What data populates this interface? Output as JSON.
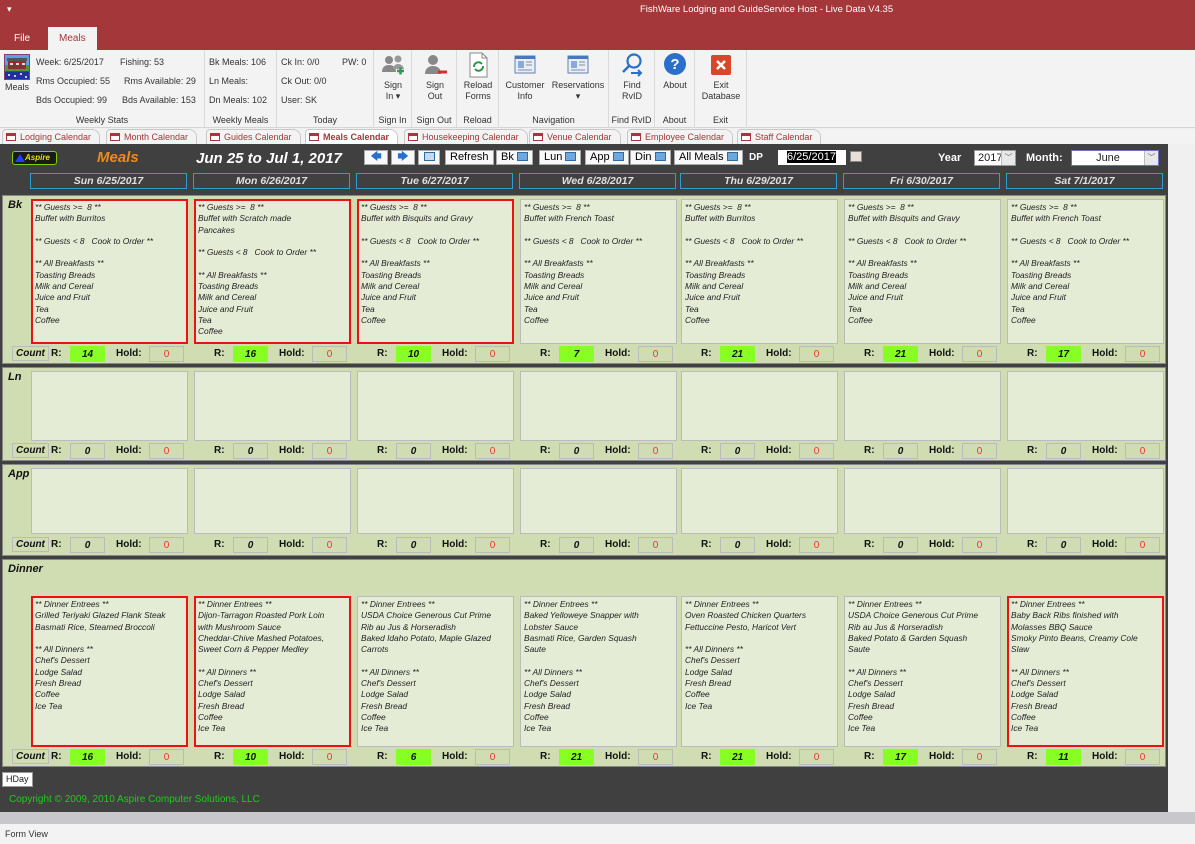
{
  "window": {
    "quick_access": "▾",
    "title": "FishWare Lodging and GuideService Host - Live Data V4.35"
  },
  "ribbon_tabs": [
    "File",
    "Meals"
  ],
  "ribbon": {
    "meals_button": "Meals",
    "weekly_stats": {
      "week": "Week:  6/25/2017",
      "fishing": "Fishing:  53",
      "rms_occupied": "Rms Occupied:  55",
      "rms_available": "Rms Available:  29",
      "bds_occupied": "Bds Occupied:    99",
      "bds_available": "Bds Available:  153",
      "label": "Weekly Stats"
    },
    "weekly_meals": {
      "bk": "Bk Meals:  106",
      "ln": "Ln Meals:",
      "dn": "Dn Meals:  102",
      "label": "Weekly Meals"
    },
    "today": {
      "ck_in": "Ck In:    0/0",
      "pw": "PW: 0",
      "ck_out": "Ck Out:  0/0",
      "user": "User: SK",
      "label": "Today"
    },
    "buttons": [
      {
        "line1": "Sign",
        "line2": "In ▾",
        "group": "Sign In"
      },
      {
        "line1": "Sign",
        "line2": "Out",
        "group": "Sign Out"
      },
      {
        "line1": "Reload",
        "line2": "Forms",
        "group": "Reload"
      },
      {
        "line1": "Customer",
        "line2": "Info",
        "group": ""
      },
      {
        "line1": "Reservations",
        "line2": "▾",
        "group": ""
      },
      {
        "line1": "Find",
        "line2": "RvID",
        "group": "Find RvID"
      },
      {
        "line1": "About",
        "line2": "",
        "group": "About"
      },
      {
        "line1": "Exit",
        "line2": "Database",
        "group": "Exit"
      }
    ],
    "navigation_label": "Navigation"
  },
  "doc_tabs": [
    "Lodging Calendar",
    "Month Calendar",
    "Guides Calendar",
    "Meals Calendar",
    "Housekeeping Calendar",
    "Venue Calendar",
    "Employee Calendar",
    "Staff Calendar"
  ],
  "active_doc_tab": "Meals Calendar",
  "header": {
    "logo": "Aspire",
    "title": "Meals",
    "range": "Jun 25 to Jul 1, 2017",
    "prev_icon": "🡄",
    "next_icon": "🡆",
    "refresh": "Refresh",
    "bk": "Bk",
    "lun": "Lun",
    "app": "App",
    "din": "Din",
    "all_meals": "All Meals",
    "dp_label": "DP",
    "dp_value": "6/25/2017",
    "year_label": "Year",
    "year_value": "2017",
    "month_label": "Month:",
    "month_value": "June",
    "days": [
      "Sun 6/25/2017",
      "Mon 6/26/2017",
      "Tue 6/27/2017",
      "Wed 6/28/2017",
      "Thu 6/29/2017",
      "Fri 6/30/2017",
      "Sat 7/1/2017"
    ]
  },
  "labels": {
    "count": "Count",
    "r": "R:",
    "hold": "Hold:"
  },
  "sections": {
    "bk": {
      "label": "Bk",
      "menus": [
        "** Guests >=  8 **\nBuffet with Burritos\n\n** Guests < 8   Cook to Order **\n\n** All Breakfasts **\nToasting Breads\nMilk and Cereal\nJuice and Fruit\nTea\nCoffee",
        "** Guests >=  8 **\nBuffet with Scratch made\nPancakes\n\n** Guests < 8   Cook to Order **\n\n** All Breakfasts **\nToasting Breads\nMilk and Cereal\nJuice and Fruit\nTea\nCoffee",
        "** Guests >=  8 **\nBuffet with Bisquits and Gravy\n\n** Guests < 8   Cook to Order **\n\n** All Breakfasts **\nToasting Breads\nMilk and Cereal\nJuice and Fruit\nTea\nCoffee",
        "** Guests >=  8 **\nBuffet with French Toast\n\n** Guests < 8   Cook to Order **\n\n** All Breakfasts **\nToasting Breads\nMilk and Cereal\nJuice and Fruit\nTea\nCoffee",
        "** Guests >=  8 **\nBuffet with Burritos\n\n** Guests < 8   Cook to Order **\n\n** All Breakfasts **\nToasting Breads\nMilk and Cereal\nJuice and Fruit\nTea\nCoffee",
        "** Guests >=  8 **\nBuffet with Bisquits and Gravy\n\n** Guests < 8   Cook to Order **\n\n** All Breakfasts **\nToasting Breads\nMilk and Cereal\nJuice and Fruit\nTea\nCoffee",
        "** Guests >=  8 **\nBuffet with French Toast\n\n** Guests < 8   Cook to Order **\n\n** All Breakfasts **\nToasting Breads\nMilk and Cereal\nJuice and Fruit\nTea\nCoffee"
      ],
      "highlighted": [
        true,
        true,
        true,
        false,
        false,
        false,
        false
      ],
      "r": [
        "14",
        "16",
        "10",
        "7",
        "21",
        "21",
        "17"
      ],
      "hold": [
        "0",
        "0",
        "0",
        "0",
        "0",
        "0",
        "0"
      ]
    },
    "ln": {
      "label": "Ln",
      "menus": [
        "",
        "",
        "",
        "",
        "",
        "",
        ""
      ],
      "highlighted": [
        false,
        false,
        false,
        false,
        false,
        false,
        false
      ],
      "r": [
        "0",
        "0",
        "0",
        "0",
        "0",
        "0",
        "0"
      ],
      "hold": [
        "0",
        "0",
        "0",
        "0",
        "0",
        "0",
        "0"
      ]
    },
    "app": {
      "label": "App",
      "menus": [
        "",
        "",
        "",
        "",
        "",
        "",
        ""
      ],
      "highlighted": [
        false,
        false,
        false,
        false,
        false,
        false,
        false
      ],
      "r": [
        "0",
        "0",
        "0",
        "0",
        "0",
        "0",
        "0"
      ],
      "hold": [
        "0",
        "0",
        "0",
        "0",
        "0",
        "0",
        "0"
      ]
    },
    "dinner": {
      "label": "Dinner",
      "menus": [
        "** Dinner Entrees **\nGrilled Teriyaki Glazed Flank Steak\nBasmati Rice, Steamed Broccoli\n\n** All Dinners **\nChef's Dessert\nLodge Salad\nFresh Bread\nCoffee\nIce Tea",
        "** Dinner Entrees **\nDijon-Tarragon Roasted Pork Loin\nwith Mushroom Sauce\nCheddar-Chive Mashed Potatoes,\nSweet Corn & Pepper Medley\n\n** All Dinners **\nChef's Dessert\nLodge Salad\nFresh Bread\nCoffee\nIce Tea",
        "** Dinner Entrees **\nUSDA Choice Generous Cut Prime\nRib au Jus & Horseradish\nBaked Idaho Potato, Maple Glazed\nCarrots\n\n** All Dinners **\nChef's Dessert\nLodge Salad\nFresh Bread\nCoffee\nIce Tea",
        "** Dinner Entrees **\nBaked Yelloweye Snapper with\nLobster Sauce\nBasmati Rice, Garden Squash\nSaute\n\n** All Dinners **\nChef's Dessert\nLodge Salad\nFresh Bread\nCoffee\nIce Tea",
        "** Dinner Entrees **\nOven Roasted Chicken Quarters\nFettuccine Pesto, Haricot Vert\n\n** All Dinners **\nChef's Dessert\nLodge Salad\nFresh Bread\nCoffee\nIce Tea",
        "** Dinner Entrees **\nUSDA Choice Generous Cut Prime\nRib au Jus & Horseradish\nBaked Potato & Garden Squash\nSaute\n\n** All Dinners **\nChef's Dessert\nLodge Salad\nFresh Bread\nCoffee\nIce Tea",
        "** Dinner Entrees **\nBaby Back Ribs finished with\nMolasses BBQ Sauce\nSmoky Pinto Beans, Creamy Cole\nSlaw\n\n** All Dinners **\nChef's Dessert\nLodge Salad\nFresh Bread\nCoffee\nIce Tea"
      ],
      "highlighted": [
        true,
        true,
        false,
        false,
        false,
        false,
        true
      ],
      "r": [
        "16",
        "10",
        "6",
        "21",
        "21",
        "17",
        "11"
      ],
      "hold": [
        "0",
        "0",
        "0",
        "0",
        "0",
        "0",
        "0"
      ]
    }
  },
  "footer": {
    "hday": "HDay",
    "copyright": "Copyright © 2009, 2010  Aspire Computer Solutions, LLC"
  },
  "status": "Form View",
  "colors": {
    "title_bar": "#a4373a",
    "section_bg": "#d0ddb3",
    "menu_bg": "#e5ecd6",
    "highlight_border": "#ee1111",
    "count_positive": "#88ff22",
    "hold_text": "#ee3333",
    "copyright_text": "#22c822",
    "meals_title": "#f08a18"
  }
}
